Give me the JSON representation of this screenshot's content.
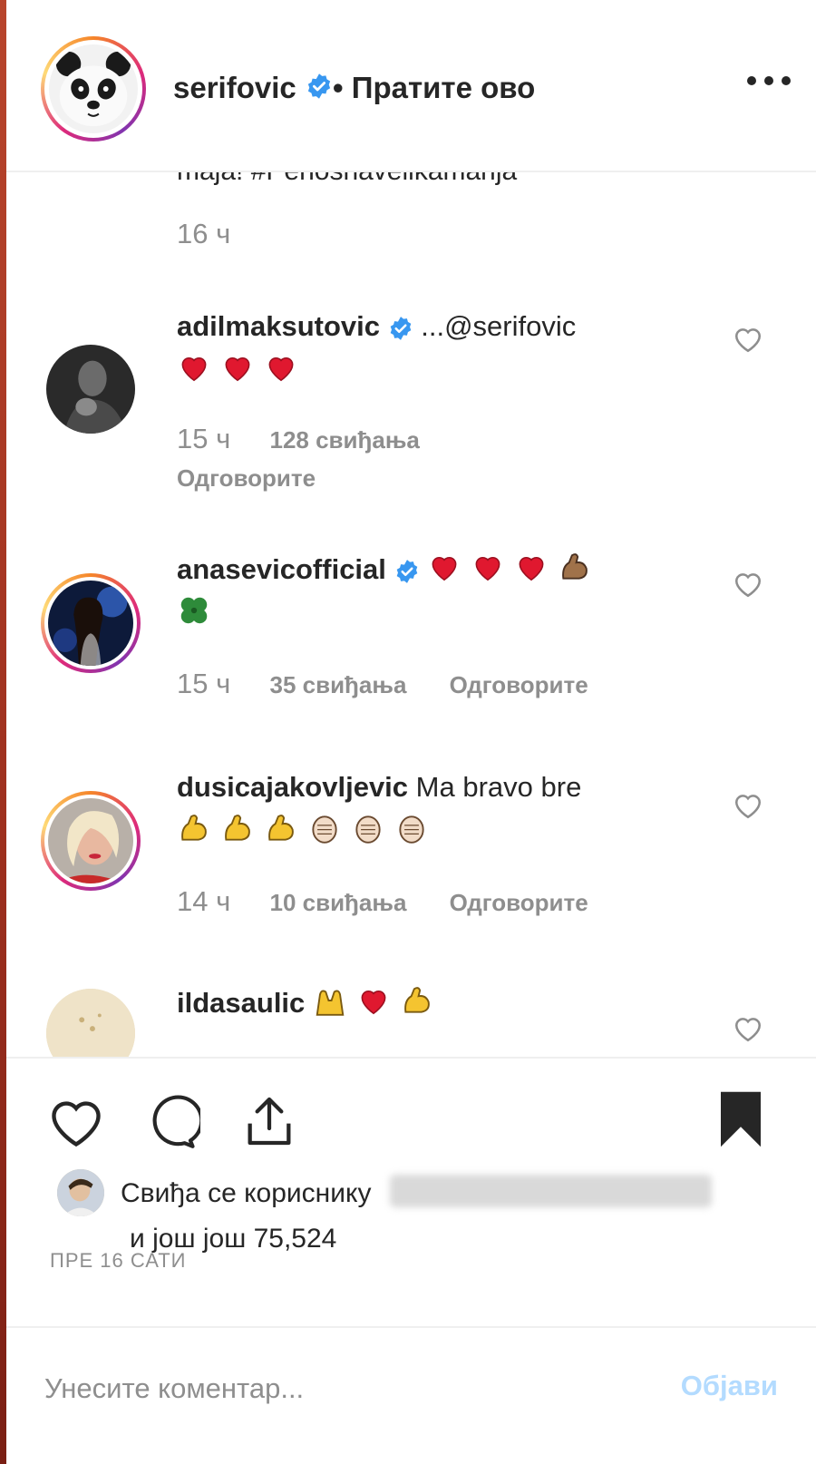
{
  "post": {
    "username": "serifovic",
    "separator": "•",
    "follow_label": "Пратите ово",
    "more_icon": "more-options-icon"
  },
  "comments_scroll": {
    "cut_text": "maja! #Penosnavelikamarija",
    "time": "16 ч"
  },
  "comments": [
    {
      "username": "adilmaksutovic",
      "verified": true,
      "text": "...@serifovic",
      "emojis": [
        "red-heart-emoji",
        "red-heart-emoji",
        "red-heart-emoji"
      ],
      "time": "15 ч",
      "likes": "128 свиђања",
      "reply": "Одговорите"
    },
    {
      "username": "anasevicofficial",
      "verified": true,
      "text": "",
      "emojis": [
        "red-heart-emoji",
        "red-heart-emoji",
        "red-heart-emoji",
        "flexed-biceps-emoji",
        "four-leaf-clover-emoji"
      ],
      "time": "15 ч",
      "likes": "35 свиђања",
      "reply": "Одговорите"
    },
    {
      "username": "dusicajakovljevic",
      "verified": false,
      "text": "Ma bravo bre",
      "emojis": [
        "flexed-biceps-emoji",
        "flexed-biceps-emoji",
        "flexed-biceps-emoji",
        "clapping-hands-emoji",
        "clapping-hands-emoji",
        "clapping-hands-emoji"
      ],
      "time": "14 ч",
      "likes": "10 свиђања",
      "reply": "Одговорите"
    },
    {
      "username": "ildasaulic",
      "verified": false,
      "text": "",
      "emojis": [
        "raising-hands-emoji",
        "red-heart-emoji",
        "flexed-biceps-emoji"
      ]
    }
  ],
  "liked_by": {
    "prefix": "Свиђа се кориснику",
    "line2": "и још још 75,524"
  },
  "post_time": "ПРЕ 16 САТИ",
  "comment_input": {
    "placeholder": "Унесите коментар...",
    "post_label": "Објави"
  },
  "colors": {
    "verified": "#3897f0",
    "heart": "#e0182f",
    "muted": "#8e8e8e",
    "post_disabled": "#b3dbff"
  }
}
